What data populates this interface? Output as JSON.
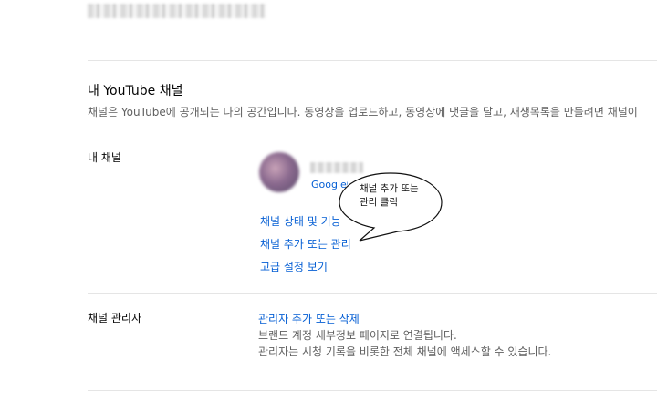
{
  "header": {
    "email_redacted": "████████████████"
  },
  "section": {
    "title": "내 YouTube 채널",
    "description": "채널은 YouTube에 공개되는 나의 공간입니다. 동영상을 업로드하고, 동영상에 댓글을 달고, 재생목록을 만들려면 채널이"
  },
  "my_channel": {
    "label": "내 채널",
    "avatar_icon": "channel-avatar",
    "name_redacted": "████",
    "account_link": "Google아",
    "links": {
      "status_features": "채널 상태 및 기능",
      "add_or_manage": "채널 추가 또는 관리",
      "advanced_settings": "고급 설정 보기"
    },
    "callout": {
      "line1": "채널 추가 또는",
      "line2": "관리 클릭"
    }
  },
  "channel_managers": {
    "label": "채널 관리자",
    "link": "관리자 추가 또는 삭제",
    "desc1": "브랜드 계정 세부정보 페이지로 연결됩니다.",
    "desc2": "관리자는 시청 기록을 비롯한 전체 채널에 액세스할 수 있습니다."
  },
  "colors": {
    "link": "#065fd4",
    "secondary_text": "#606060",
    "divider": "#e5e5e5"
  }
}
